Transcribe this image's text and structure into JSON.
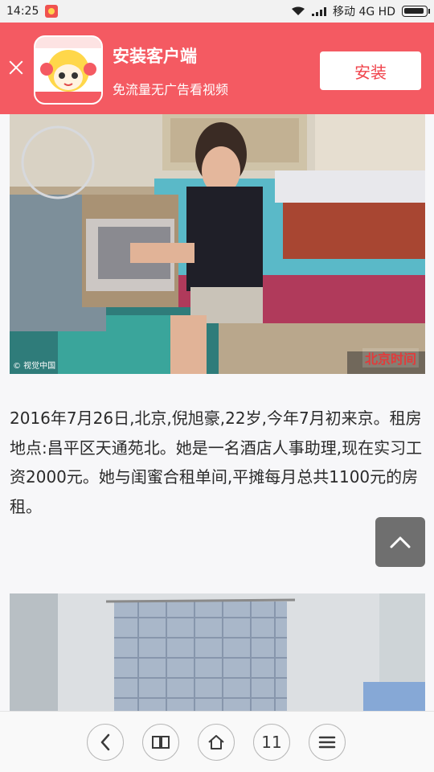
{
  "status_bar": {
    "time": "14:25",
    "carrier": "移动 4G HD"
  },
  "banner": {
    "title": "安装客户端",
    "subtitle": "免流量无广告看视频",
    "install_label": "安装",
    "accent_color": "#f45a62"
  },
  "photos": {
    "top": {
      "credit": "© 视觉中国",
      "watermark": "北京时间"
    }
  },
  "article": {
    "paragraph": "2016年7月26日,北京,倪旭豪,22岁,今年7月初来京。租房地点:昌平区天通苑北。她是一名酒店人事助理,现在实习工资2000元。她与闺蜜合租单间,平摊每月总共1100元的房租。"
  },
  "bottom_nav": {
    "tab_count": "11",
    "items": [
      "back-icon",
      "book-icon",
      "home-icon",
      "tabs-count",
      "menu-icon"
    ]
  }
}
